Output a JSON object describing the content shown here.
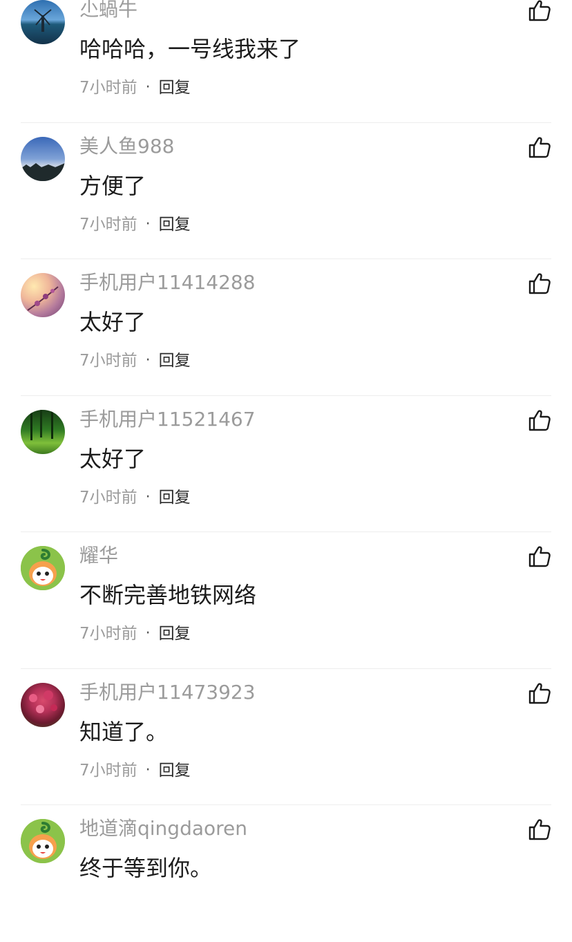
{
  "comments": [
    {
      "username": "尐蝸牛",
      "content": "哈哈哈，一号线我来了",
      "time": "7小时前",
      "dot": "·",
      "reply": "回复",
      "avatar": "windmill-photo"
    },
    {
      "username": "美人鱼988",
      "content": "方便了",
      "time": "7小时前",
      "dot": "·",
      "reply": "回复",
      "avatar": "lake-sky-photo"
    },
    {
      "username": "手机用户11414288",
      "content": "太好了",
      "time": "7小时前",
      "dot": "·",
      "reply": "回复",
      "avatar": "sunset-flower-photo"
    },
    {
      "username": "手机用户11521467",
      "content": "太好了",
      "time": "7小时前",
      "dot": "·",
      "reply": "回复",
      "avatar": "forest-photo"
    },
    {
      "username": "耀华",
      "content": "不断完善地铁网络",
      "time": "7小时前",
      "dot": "·",
      "reply": "回复",
      "avatar": "mascot-default"
    },
    {
      "username": "手机用户11473923",
      "content": "知道了。",
      "time": "7小时前",
      "dot": "·",
      "reply": "回复",
      "avatar": "flowers-photo"
    },
    {
      "username": "地道滴qingdaoren",
      "content": "终于等到你。",
      "time": "",
      "dot": "",
      "reply": "",
      "avatar": "mascot-default"
    }
  ],
  "icons": {
    "like": "thumbs-up-icon"
  }
}
